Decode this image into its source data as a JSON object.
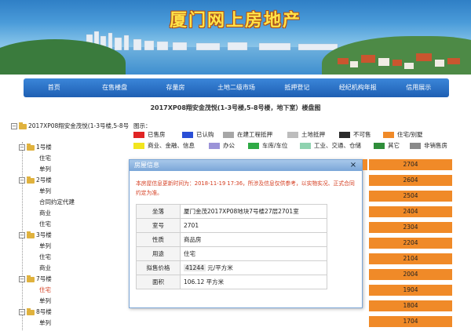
{
  "banner": {
    "title": "厦门网上房地产"
  },
  "nav": {
    "items": [
      "首页",
      "在售楼盘",
      "存量房",
      "土地二级市场",
      "抵押登记",
      "经纪机构年报",
      "信用展示"
    ]
  },
  "page_title": "2017XP08翔安金茂悦(1-3号楼,5-8号楼，地下室）楼盘图",
  "tree": {
    "root": "2017XP08翔安金茂悦(1-3号楼,5-8号楼，地下室）",
    "nodes": [
      {
        "label": "1号楼",
        "children": [
          "住宅",
          "单列"
        ]
      },
      {
        "label": "2号楼",
        "children": [
          "单列",
          "合同约定代建",
          "商业",
          "住宅"
        ]
      },
      {
        "label": "3号楼",
        "children": [
          "单列",
          "住宅",
          "商业"
        ]
      },
      {
        "label": "7号楼",
        "children": [
          "住宅",
          "单列"
        ]
      },
      {
        "label": "8号楼",
        "children": [
          "单列"
        ]
      }
    ],
    "active": "住宅"
  },
  "legend": {
    "label": "图示：",
    "items": [
      {
        "label": "已售房",
        "color": "#e02424"
      },
      {
        "label": "已认购",
        "color": "#2a4fd6"
      },
      {
        "label": "在建工程抵押",
        "color": "#a7a7a7"
      },
      {
        "label": "土地抵押",
        "color": "#bdbdbd"
      },
      {
        "label": "不可售",
        "color": "#2a2a2a"
      },
      {
        "label": "住宅/别墅",
        "color": "#f08a28"
      },
      {
        "label": "商业、金融、信息",
        "color": "#f2e51e"
      },
      {
        "label": "办公",
        "color": "#9b93d8"
      },
      {
        "label": "车库/车位",
        "color": "#2faa45"
      },
      {
        "label": "工业、交通、仓储",
        "color": "#8fd3b0"
      },
      {
        "label": "其它",
        "color": "#2f8d3a"
      },
      {
        "label": "非销售房",
        "color": "#8a8a8a"
      }
    ]
  },
  "rooms": [
    "2704",
    "2604",
    "2504",
    "2404",
    "2304",
    "2204",
    "2104",
    "2004",
    "1904",
    "1804",
    "1704"
  ],
  "dialog": {
    "title": "房屋信息",
    "close": "×",
    "notice": "本房屋信息更新时间为：2018-11-19 17:36，所涉及信息仅供参考，以实物实况、正式合同约定为准。",
    "rows": [
      {
        "key": "坐落",
        "value": "厦门金茂2017XP08地块7号楼27层2701室"
      },
      {
        "key": "室号",
        "value": "2701"
      },
      {
        "key": "性质",
        "value": "商品房"
      },
      {
        "key": "用途",
        "value": "住宅"
      },
      {
        "key": "拟售价格",
        "value": "41244",
        "unit": "元/平方米"
      },
      {
        "key": "面积",
        "value": "106.12 平方米"
      }
    ]
  }
}
